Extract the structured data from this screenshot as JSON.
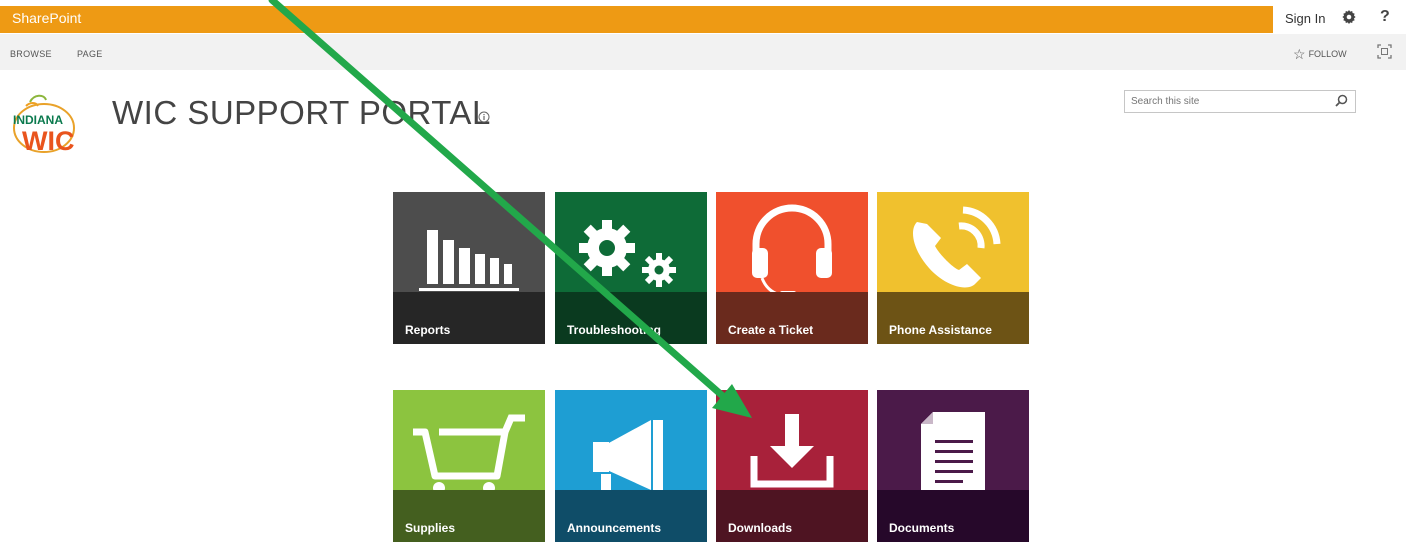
{
  "suitebar": {
    "brand": "SharePoint",
    "sign_in": "Sign In",
    "help": "?"
  },
  "ribbon": {
    "tabs": [
      "BROWSE",
      "PAGE"
    ],
    "follow": "FOLLOW"
  },
  "header": {
    "logo_text": [
      "INDIANA",
      "WIC"
    ],
    "title": "WIC SUPPORT PORTAL",
    "search_placeholder": "Search this site"
  },
  "tiles": [
    {
      "label": "Reports",
      "color": "#4d4d4d",
      "icon": "bar-chart-icon"
    },
    {
      "label": "Troubleshooting",
      "color": "#0e6b37",
      "icon": "gears-icon"
    },
    {
      "label": "Create a Ticket",
      "color": "#f0502d",
      "icon": "headset-icon"
    },
    {
      "label": "Phone Assistance",
      "color": "#f0c12e",
      "icon": "phone-icon"
    },
    {
      "label": "Supplies",
      "color": "#8cc43f",
      "icon": "shopping-cart-icon"
    },
    {
      "label": "Announcements",
      "color": "#1e9ed3",
      "icon": "megaphone-icon"
    },
    {
      "label": "Downloads",
      "color": "#a8213a",
      "icon": "download-icon"
    },
    {
      "label": "Documents",
      "color": "#4b1a49",
      "icon": "document-icon"
    }
  ],
  "colors": {
    "suitebar": "#ee9a14",
    "annotation_arrow": "#22a84a"
  }
}
